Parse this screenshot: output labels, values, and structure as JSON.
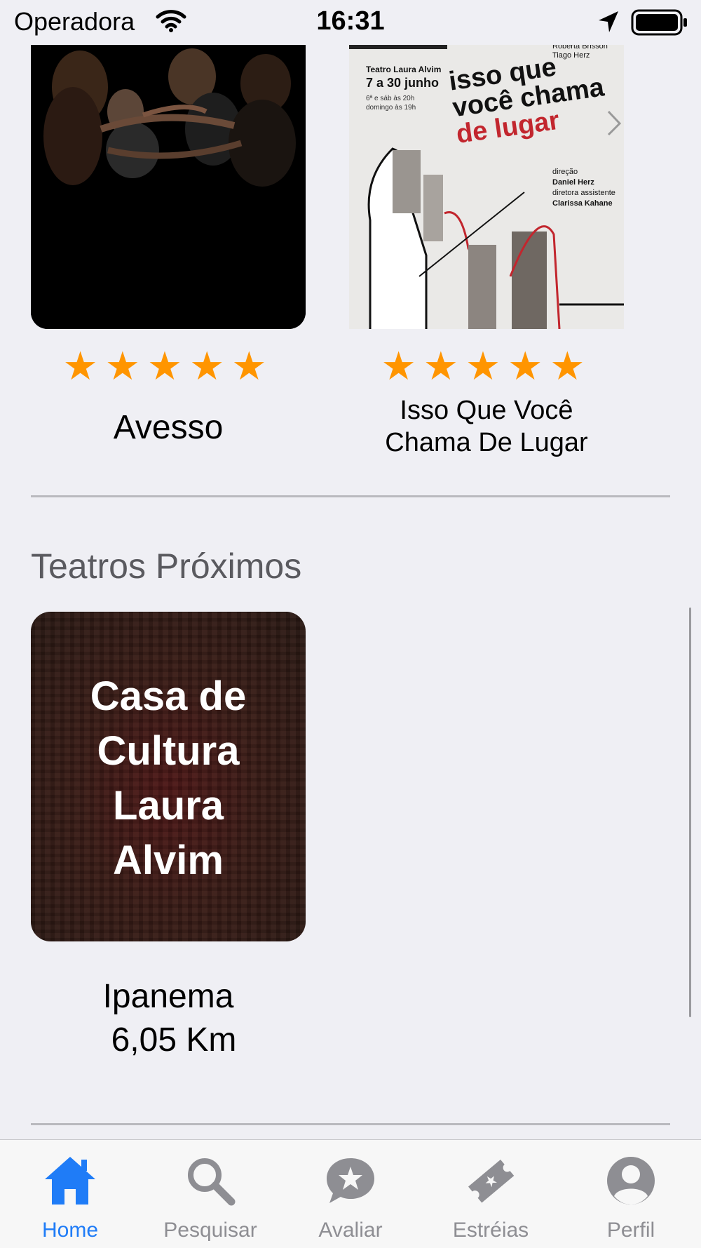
{
  "status_bar": {
    "carrier": "Operadora",
    "time": "16:31"
  },
  "plays": [
    {
      "title": "Avesso",
      "rating": 5
    },
    {
      "title_lines": [
        "Isso Que Você",
        "Chama De Lugar"
      ],
      "rating": 5
    }
  ],
  "poster_isso": {
    "venue": "Teatro Laura Alvim",
    "dates": "7 a 30 junho",
    "schedule_lines": [
      "6ª e sáb às 20h",
      "domingo às 19h"
    ],
    "cast_lines": [
      "Roberta Brisson",
      "Tiago Herz"
    ],
    "title_lines": [
      "isso que",
      "você chama",
      "de lugar"
    ],
    "credits_lines": [
      "direção",
      "Daniel Herz",
      "diretora assistente",
      "Clarissa Kahane"
    ]
  },
  "nearby": {
    "section_title": "Teatros Próximos",
    "theatres": [
      {
        "name_lines": [
          "Casa de",
          "Cultura",
          "Laura",
          "Alvim"
        ],
        "neighborhood": "Ipanema",
        "distance": "6,05 Km"
      }
    ]
  },
  "tabs": [
    {
      "label": "Home",
      "icon": "house-icon",
      "active": true
    },
    {
      "label": "Pesquisar",
      "icon": "search-icon",
      "active": false
    },
    {
      "label": "Avaliar",
      "icon": "star-bubble-icon",
      "active": false
    },
    {
      "label": "Estréias",
      "icon": "ticket-icon",
      "active": false
    },
    {
      "label": "Perfil",
      "icon": "person-icon",
      "active": false
    }
  ],
  "colors": {
    "accent": "#1f7cf7",
    "star": "#ff9500",
    "tab_inactive": "#8e8e93",
    "background": "#efeff4"
  }
}
